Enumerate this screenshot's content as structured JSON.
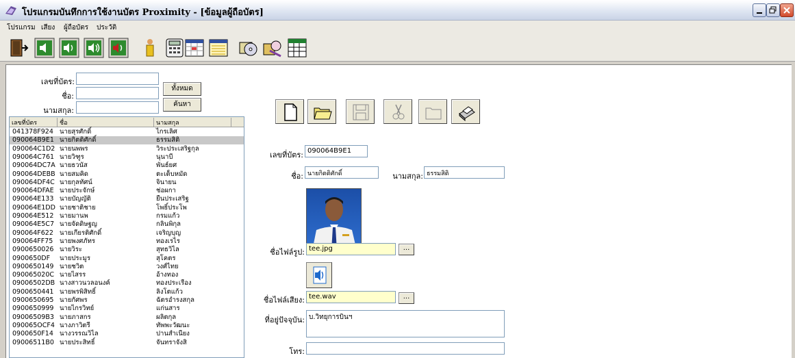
{
  "window": {
    "title": "โปรแกรมบันทึกการใช้งานบัตร Proximity - [ข้อมูลผู้ถือบัตร]"
  },
  "menu": [
    "โปรแกรม",
    "เสียง",
    "ผู้ถือบัตร",
    "ประวัติ"
  ],
  "toolbar_icons": [
    "exit-door-icon",
    "speaker-1-icon",
    "speaker-2-icon",
    "speaker-3-icon",
    "speaker-4-icon",
    "person-info-icon",
    "calculator-icon",
    "calendar-icon",
    "window-icon",
    "disk-cd-icon",
    "search-disk-icon",
    "table-icon"
  ],
  "search": {
    "card_label": "เลขที่บัตร:",
    "name_label": "ชื่อ:",
    "surname_label": "นามสกุล:",
    "card_value": "",
    "name_value": "",
    "surname_value": "",
    "all_button": "ทั้งหมด",
    "find_button": "ค้นหา"
  },
  "list": {
    "columns": [
      "เลขที่บัตร",
      "ชื่อ",
      "นามสกุล"
    ],
    "selected_index": 1,
    "rows": [
      [
        "041378F924",
        "นายสุรศักดิ์",
        "ไกรเลิศ"
      ],
      [
        "090064B9E1",
        "นายกิตติศักดิ์",
        "ธรรมสิติ"
      ],
      [
        "090064C1D2",
        "นายนพพร",
        "วิระประเสริฐกุล"
      ],
      [
        "090064C761",
        "นายวิฑูร",
        "นุนาบี"
      ],
      [
        "090064DC7A",
        "นายธวนัส",
        "พันธ์ยศ"
      ],
      [
        "090064DEBB",
        "นายสมคิด",
        "ตะเต็บหมัด"
      ],
      [
        "090064DF4C",
        "นายกุลทัศน์",
        "จินายน"
      ],
      [
        "090064DFAE",
        "นายประจักษ์",
        "ช่อผกา"
      ],
      [
        "090064E133",
        "นายบัญญัติ",
        "ยืนประเสริฐ"
      ],
      [
        "090064E1DD",
        "นายชาติชาย",
        "โพธิ์ประโพ"
      ],
      [
        "090064E512",
        "นายมานพ",
        "กรมแก้ว"
      ],
      [
        "090064E5C7",
        "นายจัดดิษฐญ",
        "กลินพิกุล"
      ],
      [
        "090064F622",
        "นายเกียรติศักดิ์",
        "เจริญบุญ"
      ],
      [
        "090064FF75",
        "นายพงศภัทร",
        "ทองเรไร"
      ],
      [
        "0900650026",
        "นายวิระ",
        "สุทธวิไล"
      ],
      [
        "0900650DF",
        "นายประมูร",
        "สุโคตร"
      ],
      [
        "0900650149",
        "นายชวิต",
        "วงศ์ไทย"
      ],
      [
        "090065020C",
        "นายไสรร",
        "อ้างทอง"
      ],
      [
        "09006502DB",
        "นางสาวนวลอนงค์",
        "ทองประเรือง"
      ],
      [
        "0900650441",
        "นายพรพิสิทธิ์",
        "ลิงโตแก้ว"
      ],
      [
        "0900650695",
        "นายกัศพร",
        "ฉัตรอำรงสกุล"
      ],
      [
        "0900650999",
        "นายไกรวิทย์",
        "แก่นสาร"
      ],
      [
        "09006509B3",
        "นายภาสกร",
        "ผลิตกุล"
      ],
      [
        "090065OCF4",
        "นางภาวิตรี",
        "ทัพพะวัฒนะ"
      ],
      [
        "0900650F14",
        "นางวรรณวิไล",
        "ปานสำเนียง"
      ],
      [
        "09006511B0",
        "นายประสิทธิ์",
        "จันทราจังสิ"
      ]
    ]
  },
  "action_buttons": [
    "new-file-icon",
    "open-folder-icon",
    "save-disk-icon",
    "cut-scissors-icon",
    "folder-disabled-icon",
    "print-icon"
  ],
  "detail": {
    "card_label": "เลขที่บัตร:",
    "card_value": "090064B9E1",
    "name_label": "ชื่อ:",
    "name_value": "นายกิตติศักดิ์",
    "surname_label": "นามสกุล:",
    "surname_value": "ธรรมสิติ",
    "image_file_label": "ชื่อไฟล์รูป:",
    "image_file_value": "tee.jpg",
    "sound_file_label": "ชื่อไฟล์เสียง:",
    "sound_file_value": "tee.wav",
    "address_label": "ที่อยู่ปัจจุบัน:",
    "address_value": "บ.วิทยุการบินฯ",
    "phone_label": "โทร:",
    "phone_value": "",
    "browse_label": "..."
  }
}
